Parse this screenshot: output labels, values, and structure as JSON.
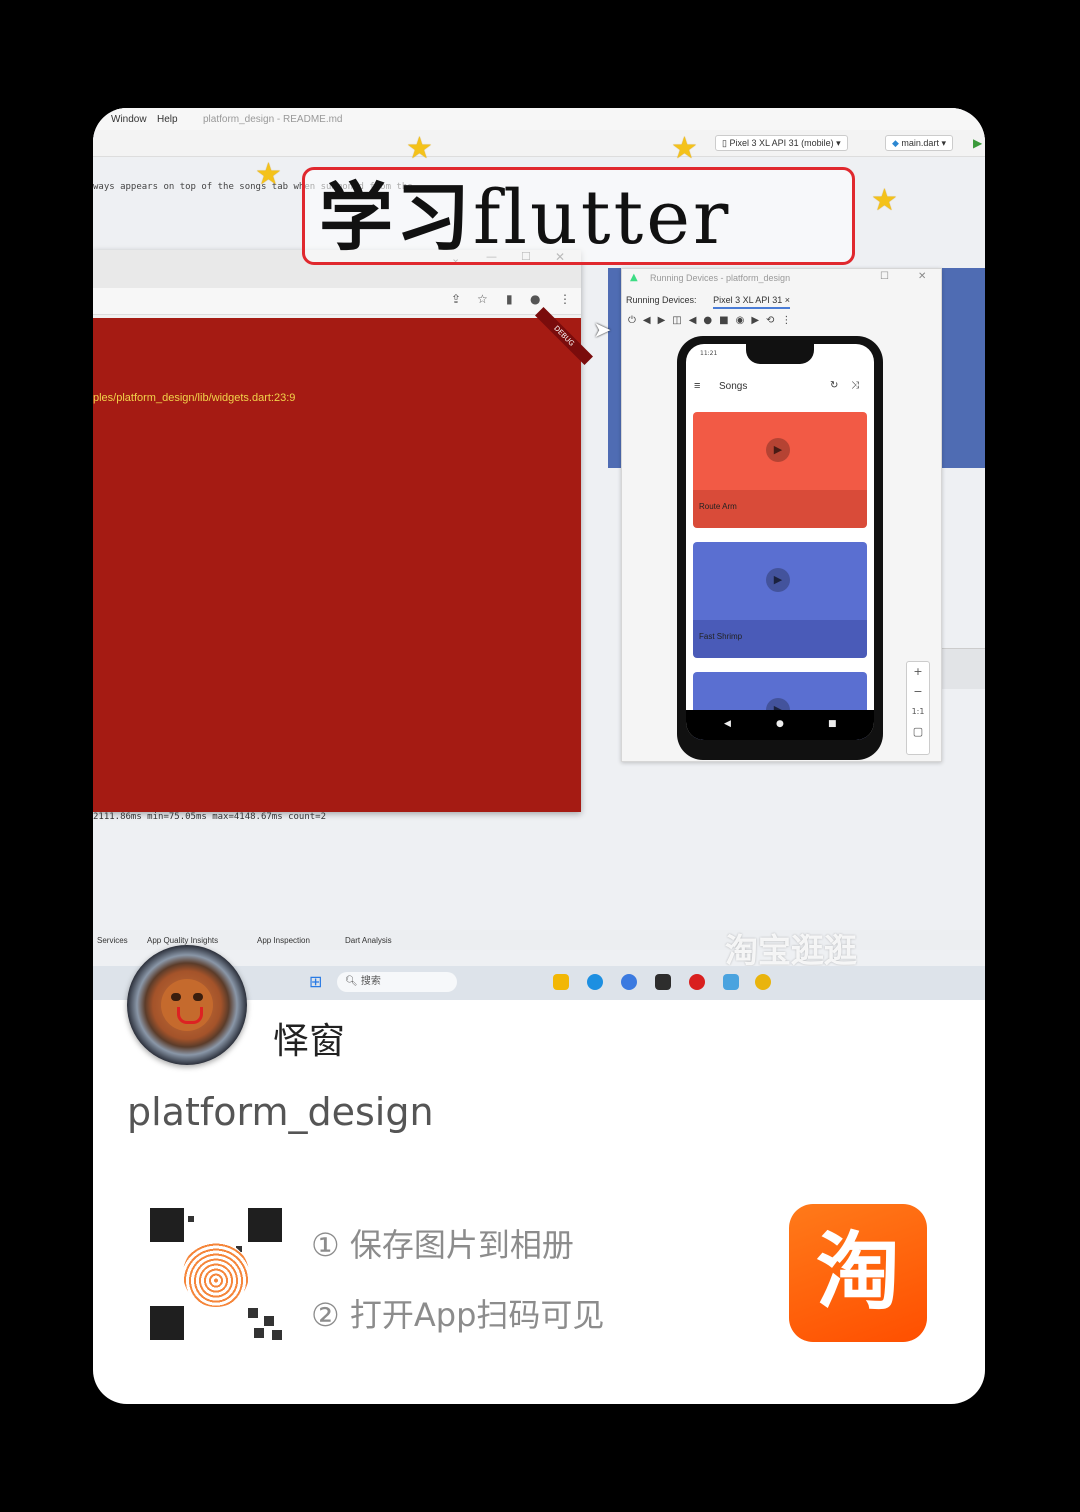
{
  "screenshot": {
    "menu": {
      "window": "Window",
      "help": "Help",
      "file": "platform_design - README.md"
    },
    "device_selector": "Pixel 3 XL API 31 (mobile)",
    "run_config": "main.dart",
    "code_line": "ways appears on top of the songs tab when summoned from the",
    "overlay_title_cn": "学习",
    "overlay_title_en": "flutter",
    "error_path": "ples/platform_design/lib/widgets.dart:23:9",
    "debug_label": "DEBUG",
    "timing_line": "2111.86ms min=75.05ms max=4148.67ms count=2",
    "running_devices_title": "Running Devices - platform_design",
    "running_devices_label": "Running Devices:",
    "running_devices_tab": "Pixel 3 XL API 31",
    "phone": {
      "time": "11:21",
      "app_title": "Songs",
      "songs": [
        {
          "name": "Route Arm",
          "top_color": "#f25a45",
          "bottom_color": "#d94b39"
        },
        {
          "name": "Fast Shrimp",
          "top_color": "#5a6fd1",
          "bottom_color": "#4a5bb8"
        },
        {
          "name": "",
          "top_color": "#5a6fd1",
          "bottom_color": "#4a5bb8"
        }
      ]
    },
    "zoom": {
      "plus": "+",
      "minus": "−",
      "ratio": "1:1"
    },
    "ide_bottom": {
      "services": "Services",
      "insights": "App Quality Insights",
      "inspection": "App Inspection",
      "dart": "Dart Analysis"
    },
    "watermark": "淘宝逛逛",
    "taskbar_search": "搜索"
  },
  "author": "怿窗",
  "caption": "platform_design",
  "steps": [
    "① 保存图片到相册",
    "② 打开App扫码可见"
  ],
  "taobao_glyph": "淘",
  "colors": {
    "accent": "#ff5000",
    "error_red": "#a51b13",
    "title_box": "#e0282e"
  }
}
